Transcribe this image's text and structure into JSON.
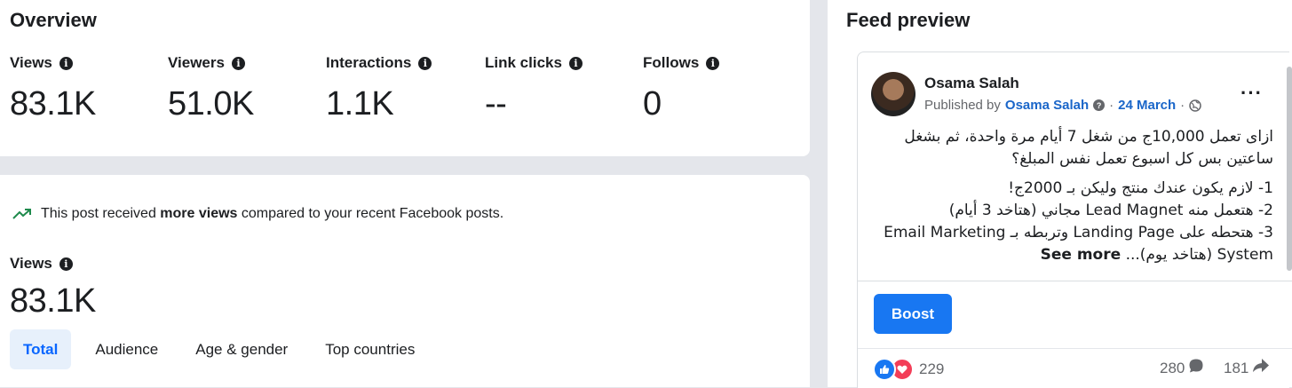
{
  "overview": {
    "title": "Overview",
    "metrics": [
      {
        "label": "Views",
        "value": "83.1K"
      },
      {
        "label": "Viewers",
        "value": "51.0K"
      },
      {
        "label": "Interactions",
        "value": "1.1K"
      },
      {
        "label": "Link clicks",
        "value": "--"
      },
      {
        "label": "Follows",
        "value": "0"
      }
    ]
  },
  "detail": {
    "notice_prefix": "This post received ",
    "notice_bold": "more views",
    "notice_suffix": " compared to your recent Facebook posts.",
    "views_label": "Views",
    "views_value": "83.1K",
    "tabs": [
      "Total",
      "Audience",
      "Age & gender",
      "Top countries"
    ],
    "active_tab": "Total"
  },
  "feed": {
    "title": "Feed preview",
    "author": "Osama Salah",
    "published_prefix": "Published by",
    "published_by": "Osama Salah",
    "date": "24 March",
    "text_line1": "ازاى تعمل 10,000ج من شغل 7 أيام مرة واحدة، ثم بشغل ساعتين بس كل اسبوع تعمل نفس المبلغ؟",
    "text_item1": "1- لازم يكون عندك منتج وليكن بـ 2000ج!",
    "text_item2": "2- هتعمل منه Lead Magnet مجاني (هتاخد 3 أيام)",
    "text_item3": "3- هتحطه على Landing Page وتربطه بـ Email Marketing System (هتاخد يوم)...",
    "see_more": "See more",
    "boost_label": "Boost",
    "reactions_count": "229",
    "comments_count": "280",
    "shares_count": "181"
  },
  "colors": {
    "accent": "#1877f2",
    "tab_active_bg": "#e7f0fb",
    "link": "#1a66c9",
    "love": "#f33e58"
  }
}
